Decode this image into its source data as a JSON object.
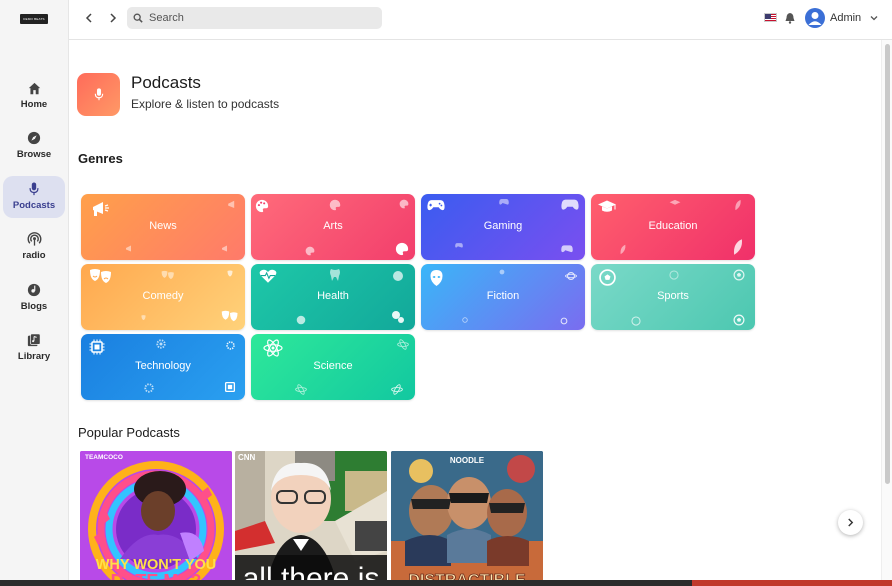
{
  "sidebar": {
    "logo_text": "DEMO BEATS",
    "items": [
      {
        "label": "Home",
        "icon": "home-icon"
      },
      {
        "label": "Browse",
        "icon": "compass-icon"
      },
      {
        "label": "Podcasts",
        "icon": "microphone-icon",
        "active": true
      },
      {
        "label": "radio",
        "icon": "radio-icon"
      },
      {
        "label": "Blogs",
        "icon": "blog-icon"
      },
      {
        "label": "Library",
        "icon": "library-icon"
      }
    ]
  },
  "topbar": {
    "search_placeholder": "Search",
    "user_name": "Admin",
    "flag_icon": "us-flag-icon",
    "bell_icon": "bell-icon"
  },
  "hero": {
    "title": "Podcasts",
    "subtitle": "Explore & listen to podcasts",
    "icon": "microphone-icon",
    "icon_color": "#ff7a5c"
  },
  "genres": {
    "title": "Genres",
    "items": [
      {
        "label": "News",
        "icon": "megaphone-icon",
        "colors": [
          "#ffa04a",
          "#ff7a6a"
        ]
      },
      {
        "label": "Arts",
        "icon": "palette-icon",
        "colors": [
          "#ff6b7a",
          "#f23e6c"
        ]
      },
      {
        "label": "Gaming",
        "icon": "gamepad-icon",
        "colors": [
          "#3a5cf0",
          "#7a4ff0"
        ]
      },
      {
        "label": "Education",
        "icon": "graduation-cap-icon",
        "colors": [
          "#ff5f6d",
          "#f0306a"
        ]
      },
      {
        "label": "Comedy",
        "icon": "masks-icon",
        "colors": [
          "#ffb15a",
          "#ffd27a"
        ]
      },
      {
        "label": "Health",
        "icon": "heartbeat-icon",
        "colors": [
          "#1ec8a8",
          "#12a89a"
        ]
      },
      {
        "label": "Fiction",
        "icon": "alien-icon",
        "colors": [
          "#3ab6f8",
          "#7a6cf0"
        ]
      },
      {
        "label": "Sports",
        "icon": "soccer-ball-icon",
        "colors": [
          "#7ad9c8",
          "#4cc7b0"
        ]
      },
      {
        "label": "Technology",
        "icon": "chip-icon",
        "colors": [
          "#1a7fe0",
          "#2aa0f0"
        ]
      },
      {
        "label": "Science",
        "icon": "atom-icon",
        "colors": [
          "#2ee89a",
          "#12c8a0"
        ]
      }
    ]
  },
  "popular": {
    "title": "Popular Podcasts",
    "covers": [
      {
        "brand": "TEAMCOCO",
        "title": "WHY WON'T YOU DATE ME?"
      },
      {
        "brand": "CNN",
        "title": "all there is"
      },
      {
        "brand": "NOODLE",
        "title": "DISTRACTIBLE"
      }
    ]
  }
}
